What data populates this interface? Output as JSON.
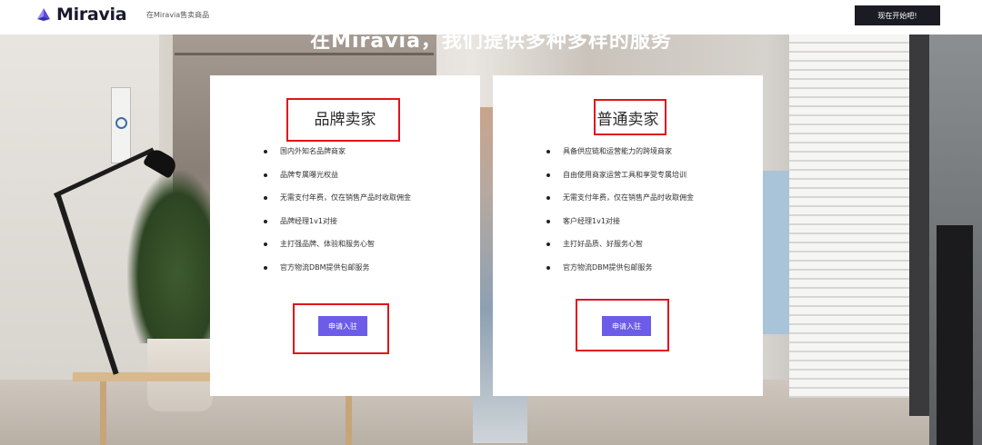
{
  "header": {
    "logo_text": "Miravia",
    "nav_sell": "在Miravia售卖商品",
    "start_button": "现在开始吧!"
  },
  "hero": {
    "title": "在Miravia，我们提供多种多样的服务"
  },
  "cards": [
    {
      "title": "品牌卖家",
      "features": [
        "国内外知名品牌商家",
        "品牌专属曝光权益",
        "无需支付年费，仅在销售产品时收取佣金",
        "品牌经理1v1对接",
        "主打强品牌、体验和服务心智",
        "官方物流DBM提供包邮服务"
      ],
      "button": "申请入驻"
    },
    {
      "title": "普通卖家",
      "features": [
        "具备供应链和运营能力的跨境商家",
        "自由使用商家运营工具和享受专属培训",
        "无需支付年费，仅在销售产品时收取佣金",
        "客户经理1v1对接",
        "主打好品质、好服务心智",
        "官方物流DBM提供包邮服务"
      ],
      "button": "申请入驻"
    }
  ],
  "colors": {
    "accent": "#6c5ce7",
    "header_button": "#1b1b24",
    "highlight": "#e0141b"
  }
}
